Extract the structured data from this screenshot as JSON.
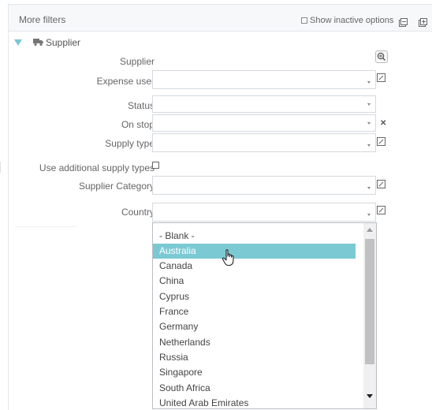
{
  "panel": {
    "title": "More filters",
    "show_inactive_label": "Show inactive options",
    "header_icons": [
      "collapse-all-icon",
      "expand-all-icon"
    ]
  },
  "section": {
    "title": "Supplier",
    "icon": "truck-icon",
    "expanded": true
  },
  "fields": {
    "supplier": {
      "label": "Supplier"
    },
    "expense_user": {
      "label": "Expense user",
      "value": ""
    },
    "status": {
      "label": "Status",
      "value": ""
    },
    "on_stop": {
      "label": "On stop",
      "value": ""
    },
    "supply_type": {
      "label": "Supply type",
      "value": ""
    },
    "use_additional": {
      "label": "Use additional supply types",
      "checked": false
    },
    "supplier_category": {
      "label": "Supplier Category",
      "value": ""
    },
    "country": {
      "label": "Country",
      "value": ""
    }
  },
  "country_dropdown": {
    "highlighted": "Australia",
    "options": [
      "- Blank -",
      "Australia",
      "Canada",
      "China",
      "Cyprus",
      "France",
      "Germany",
      "Netherlands",
      "Russia",
      "Singapore",
      "South Africa",
      "United Arab Emirates"
    ]
  },
  "colors": {
    "highlight": "#7bc9d3",
    "accent": "#7ac7d3",
    "border": "#d5d9de"
  }
}
